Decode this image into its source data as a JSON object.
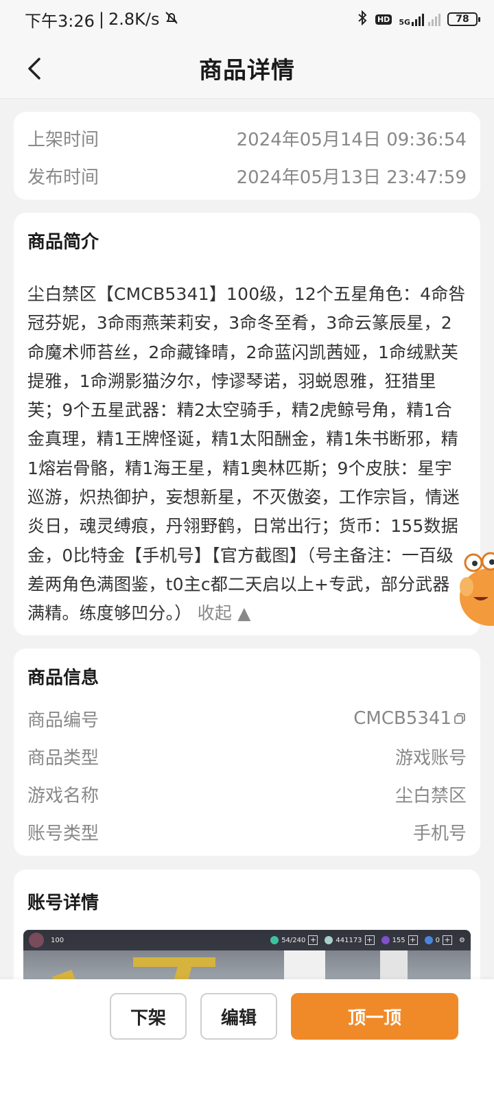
{
  "status_bar": {
    "time": "下午3:26",
    "net_speed": "2.8K/s",
    "network": "5G",
    "battery": "78",
    "icons": [
      "bell-off-icon",
      "bluetooth-icon",
      "hd-icon",
      "signal-icon",
      "battery-icon"
    ]
  },
  "nav": {
    "back_icon": "chevron-left-icon",
    "title": "商品详情"
  },
  "time_card": {
    "rows": [
      {
        "key": "上架时间",
        "value": "2024年05月14日 09:36:54"
      },
      {
        "key": "发布时间",
        "value": "2024年05月13日 23:47:59"
      }
    ]
  },
  "intro_card": {
    "title": "商品简介",
    "text": "尘白禁区【CMCB5341】100级，12个五星角色：4命咎冠芬妮，3命雨燕茉莉安，3命冬至肴，3命云篆辰星，2命魔术师苔丝，2命藏锋晴，2命蓝闪凯茜娅，1命绒默芙提雅，1命溯影猫汐尔，悖谬琴诺，羽蜕恩雅，狂猎里芙；9个五星武器：精2太空骑手，精2虎鲸号角，精1合金真理，精1王牌怪诞，精1太阳酬金，精1朱书断邪，精1熔岩骨骼，精1海王星，精1奥林匹斯；9个皮肤：星宇巡游，炽热御护，妄想新星，不灭傲姿，工作宗旨，情迷炎日，魂灵缚痕，丹翎野鹤，日常出行；货币：155数据金，0比特金【手机号】【官方截图】（号主备注：一百级差两角色满图鉴，t0主c都二天启以上+专武，部分武器满精。练度够凹分。）",
    "collapse_label": "收起 ▲"
  },
  "info_card": {
    "title": "商品信息",
    "rows": [
      {
        "key": "商品编号",
        "value": "CMCB5341",
        "copy_icon": "copy-icon"
      },
      {
        "key": "商品类型",
        "value": "游戏账号"
      },
      {
        "key": "游戏名称",
        "value": "尘白禁区"
      },
      {
        "key": "账号类型",
        "value": "手机号"
      }
    ]
  },
  "account_card": {
    "title": "账号详情",
    "screenshot_hud": {
      "level": "100",
      "stamina": "54/240",
      "currency_a": "441173",
      "currency_b": "155",
      "currency_c": "0"
    }
  },
  "bottom_bar": {
    "delist_label": "下架",
    "edit_label": "编辑",
    "bump_label": "顶一顶"
  },
  "colors": {
    "primary": "#f08a28",
    "background": "#f2f2f2",
    "card": "#ffffff",
    "muted_text": "#888888"
  }
}
